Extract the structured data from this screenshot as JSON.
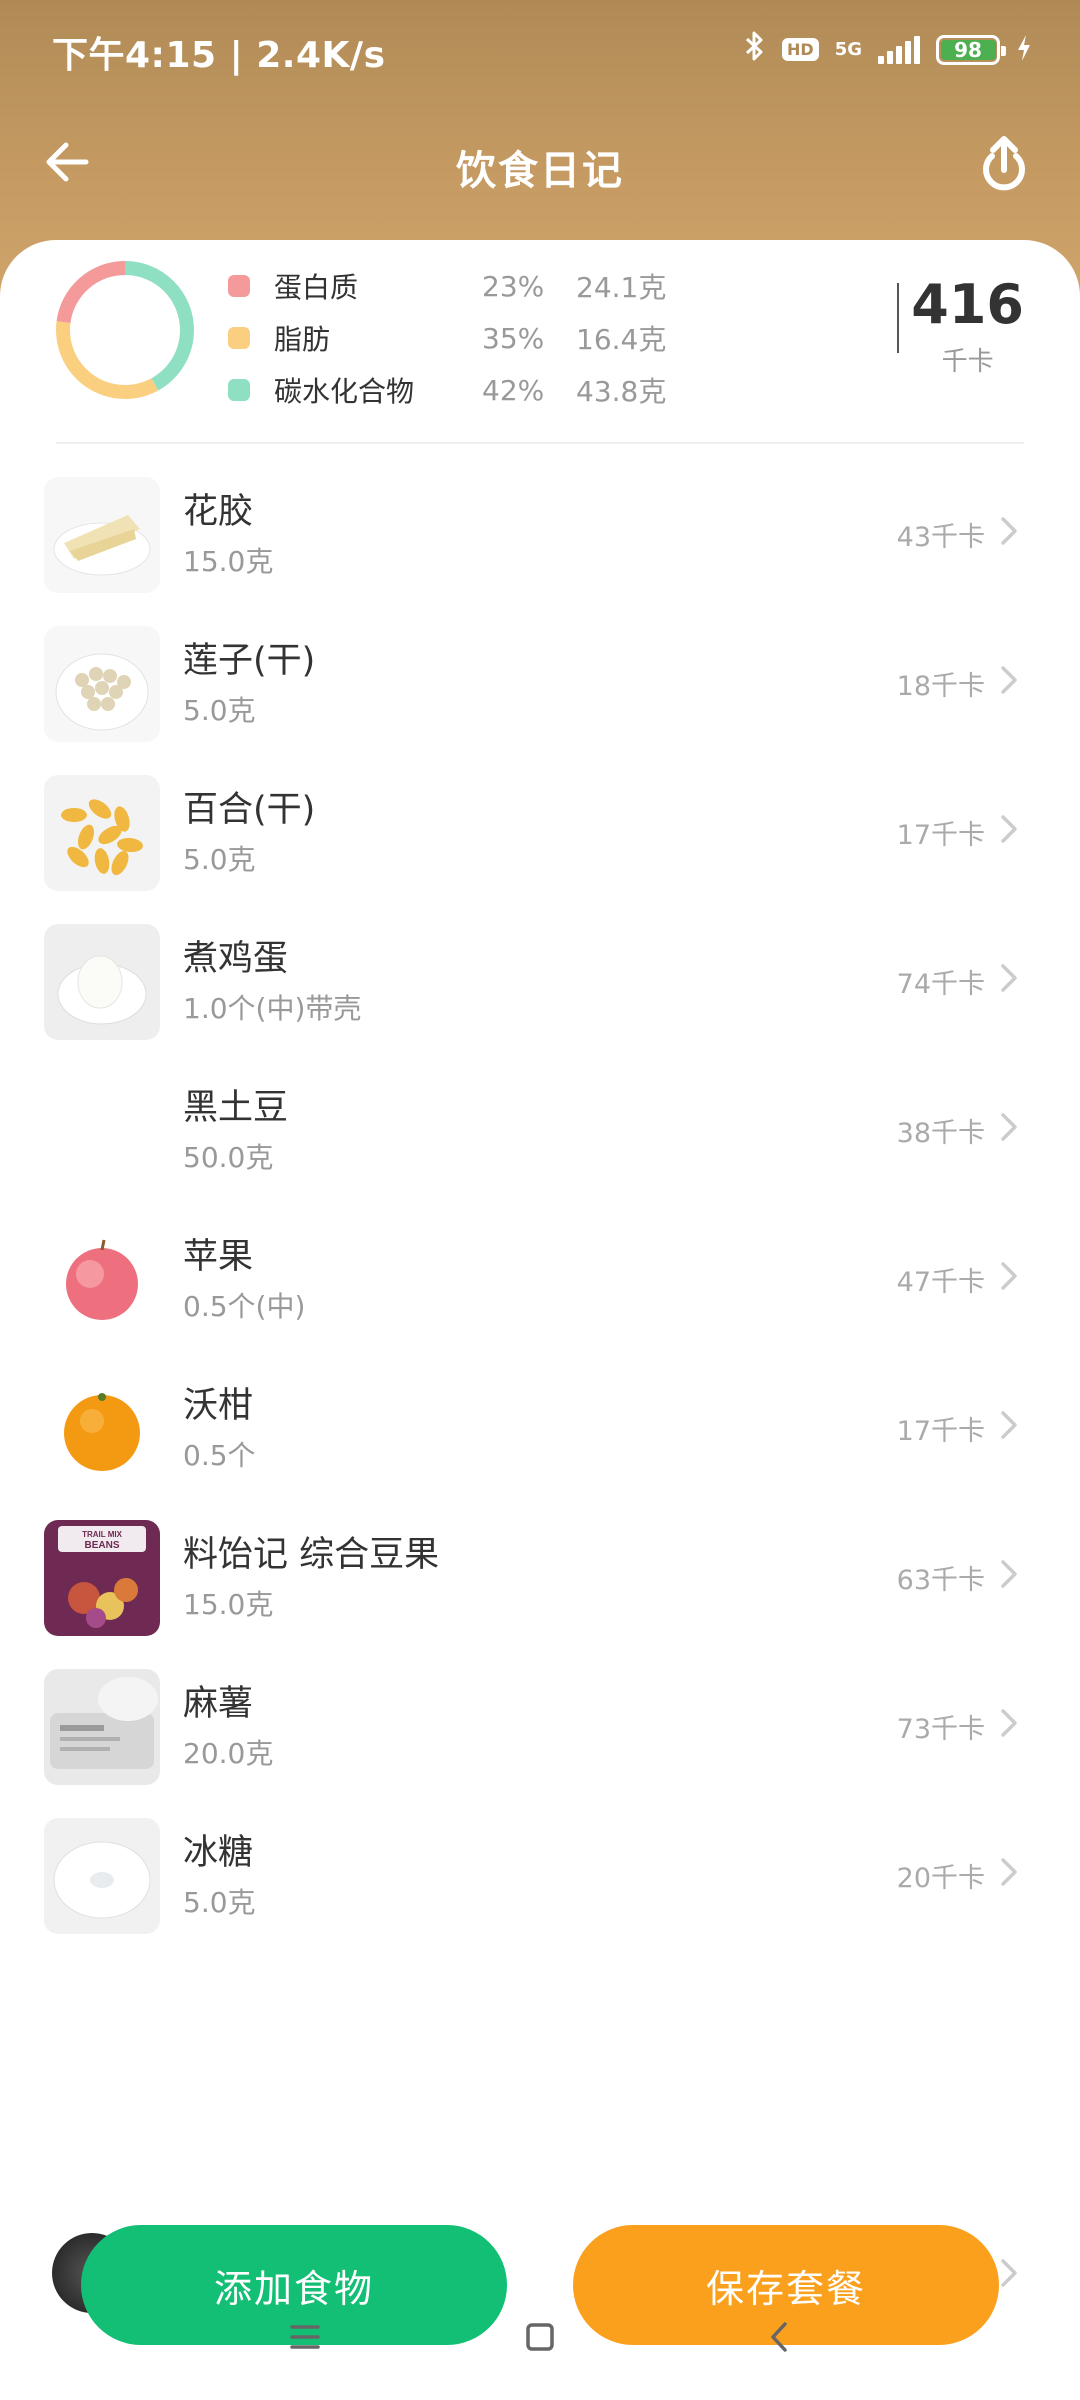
{
  "status_bar": {
    "time_speed": "下午4:15 | 2.4K/s",
    "hd": "HD",
    "network": "5G",
    "battery": "98"
  },
  "header": {
    "title": "饮食日记"
  },
  "summary": {
    "macros": [
      {
        "name": "蛋白质",
        "pct": "23%",
        "amount": "24.1克",
        "color": "#f49a9a"
      },
      {
        "name": "脂肪",
        "pct": "35%",
        "amount": "16.4克",
        "color": "#fbcf80"
      },
      {
        "name": "碳水化合物",
        "pct": "42%",
        "amount": "43.8克",
        "color": "#8fdfc2"
      }
    ],
    "total_value": "416",
    "total_unit": "千卡"
  },
  "foods": [
    {
      "name": "花胶",
      "qty": "15.0克",
      "cal": "43千卡",
      "thumb": "fish-maw-thumbnail"
    },
    {
      "name": "莲子(干)",
      "qty": "5.0克",
      "cal": "18千卡",
      "thumb": "lotus-seed-thumbnail"
    },
    {
      "name": "百合(干)",
      "qty": "5.0克",
      "cal": "17千卡",
      "thumb": "lily-bulb-thumbnail"
    },
    {
      "name": "煮鸡蛋",
      "qty": "1.0个(中)带壳",
      "cal": "74千卡",
      "thumb": "boiled-egg-thumbnail"
    },
    {
      "name": "黑土豆",
      "qty": "50.0克",
      "cal": "38千卡",
      "thumb": ""
    },
    {
      "name": "苹果",
      "qty": "0.5个(中)",
      "cal": "47千卡",
      "thumb": "apple-thumbnail"
    },
    {
      "name": "沃柑",
      "qty": "0.5个",
      "cal": "17千卡",
      "thumb": "mandarin-thumbnail"
    },
    {
      "name": "料饴记 综合豆果",
      "qty": "15.0克",
      "cal": "63千卡",
      "thumb": "trail-mix-beans-thumbnail",
      "package_text": "TRAIL MIX BEANS"
    },
    {
      "name": " 麻薯",
      "qty": "20.0克",
      "cal": "73千卡",
      "thumb": "mochi-thumbnail"
    },
    {
      "name": "冰糖",
      "qty": "5.0克",
      "cal": "20千卡",
      "thumb": "rock-sugar-thumbnail"
    }
  ],
  "actions": {
    "add_label": "添加食物",
    "save_label": "保存套餐",
    "add_color": "#12bf74",
    "save_color": "#fba01c"
  },
  "icons": {
    "back": "back-arrow-icon",
    "share": "upload-icon",
    "chevron": "chevron-right-icon",
    "menu": "menu-icon",
    "home": "home-icon",
    "sys_back": "back-icon"
  }
}
